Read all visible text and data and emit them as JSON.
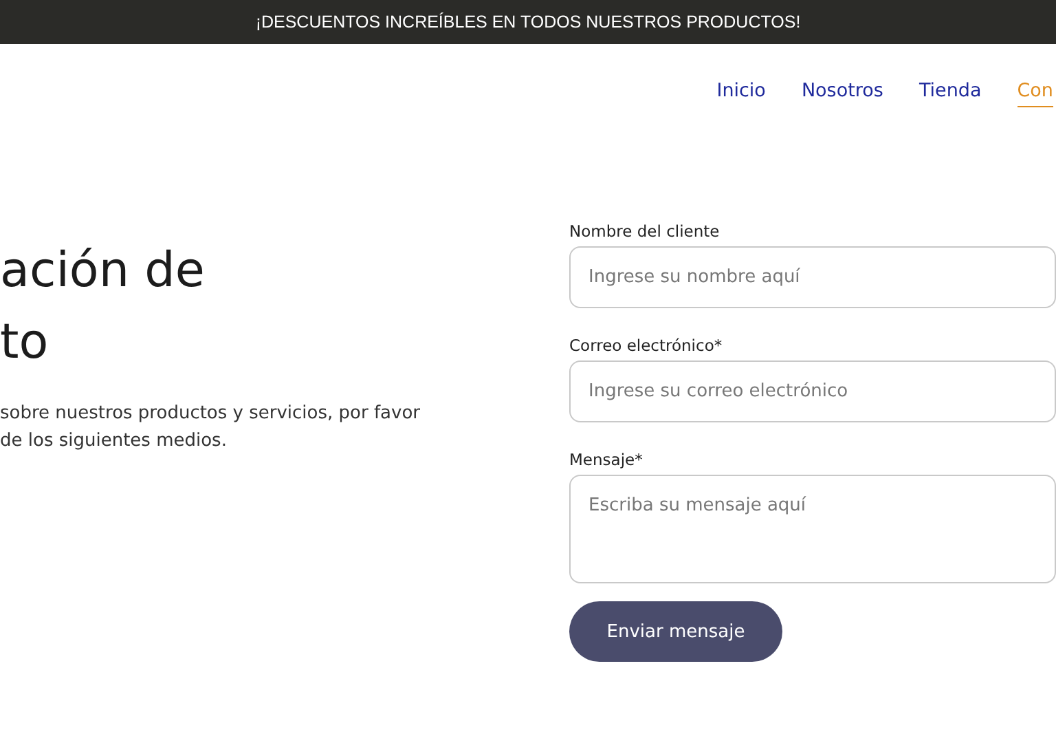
{
  "announcement": "¡DESCUENTOS INCREÍBLES EN TODOS NUESTROS PRODUCTOS!",
  "nav": [
    {
      "label": "Inicio",
      "selected": false
    },
    {
      "label": "Nosotros",
      "selected": false
    },
    {
      "label": "Tienda",
      "selected": false
    },
    {
      "label": "Con",
      "selected": true
    }
  ],
  "heading_lines": [
    "ación de",
    "to"
  ],
  "intro_lines": [
    "sobre nuestros productos y servicios, por favor",
    "de los siguientes medios."
  ],
  "form": {
    "fields": [
      {
        "label": "Nombre del cliente",
        "placeholder": "Ingrese su nombre aquí",
        "kind": "input"
      },
      {
        "label": "Correo electrónico*",
        "placeholder": "Ingrese su correo electrónico",
        "kind": "input"
      },
      {
        "label": "Mensaje*",
        "placeholder": "Escriba su mensaje aquí",
        "kind": "textarea"
      }
    ],
    "submit": "Enviar mensaje"
  }
}
